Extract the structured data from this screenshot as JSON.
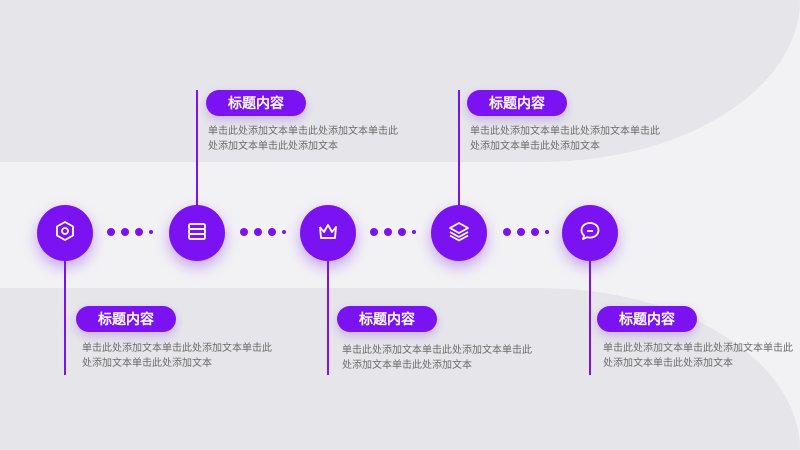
{
  "colors": {
    "accent": "#7a12f2",
    "band": "#e6e6ea",
    "text": "#6b6b6b"
  },
  "steps": [
    {
      "icon": "hexagon-nut-icon",
      "title": "标题内容",
      "text": "单击此处添加文本单击此处添加文本单击此处添加文本单击此处添加文本"
    },
    {
      "icon": "layers-stack-icon",
      "title": "标题内容",
      "text": "单击此处添加文本单击此处添加文本单击此处添加文本单击此处添加文本"
    },
    {
      "icon": "crown-basket-icon",
      "title": "标题内容",
      "text": "单击此处添加文本单击此处添加文本单击此处添加文本单击此处添加文本"
    },
    {
      "icon": "stacked-layers-icon",
      "title": "标题内容",
      "text": "单击此处添加文本单击此处添加文本单击此处添加文本单击此处添加文本"
    },
    {
      "icon": "chat-bubble-icon",
      "title": "标题内容",
      "text": "单击此处添加文本单击此处添加文本单击此处添加文本单击此处添加文本"
    }
  ]
}
